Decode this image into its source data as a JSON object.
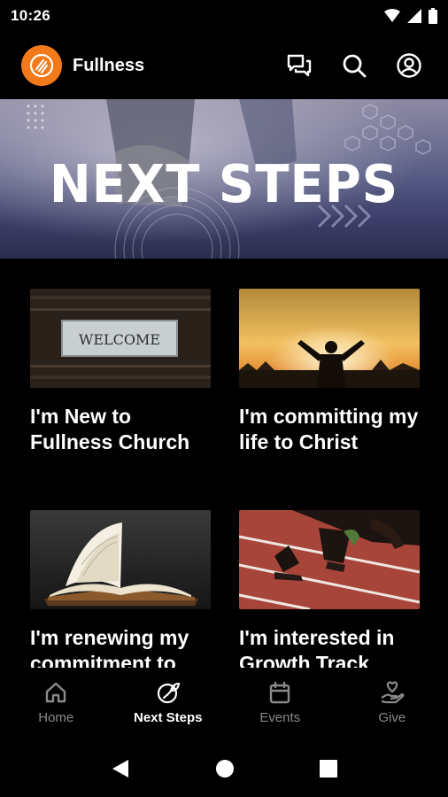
{
  "status": {
    "time": "10:26"
  },
  "app": {
    "title": "Fullness"
  },
  "hero": {
    "text": "NEXT STEPS"
  },
  "cards": [
    {
      "title": "I'm New to Fullness Church",
      "image_label": "WELCOME"
    },
    {
      "title": "I'm committing my life to Christ"
    },
    {
      "title": "I'm renewing my commitment to"
    },
    {
      "title": "I'm interested in Growth Track"
    }
  ],
  "nav": [
    {
      "label": "Home",
      "icon": "home-icon"
    },
    {
      "label": "Next Steps",
      "icon": "sprout-icon",
      "active": true
    },
    {
      "label": "Events",
      "icon": "calendar-icon"
    },
    {
      "label": "Give",
      "icon": "heart-hand-icon"
    }
  ],
  "colors": {
    "accent": "#f27a1a",
    "background": "#000000",
    "inactive": "#8a8a8a"
  }
}
